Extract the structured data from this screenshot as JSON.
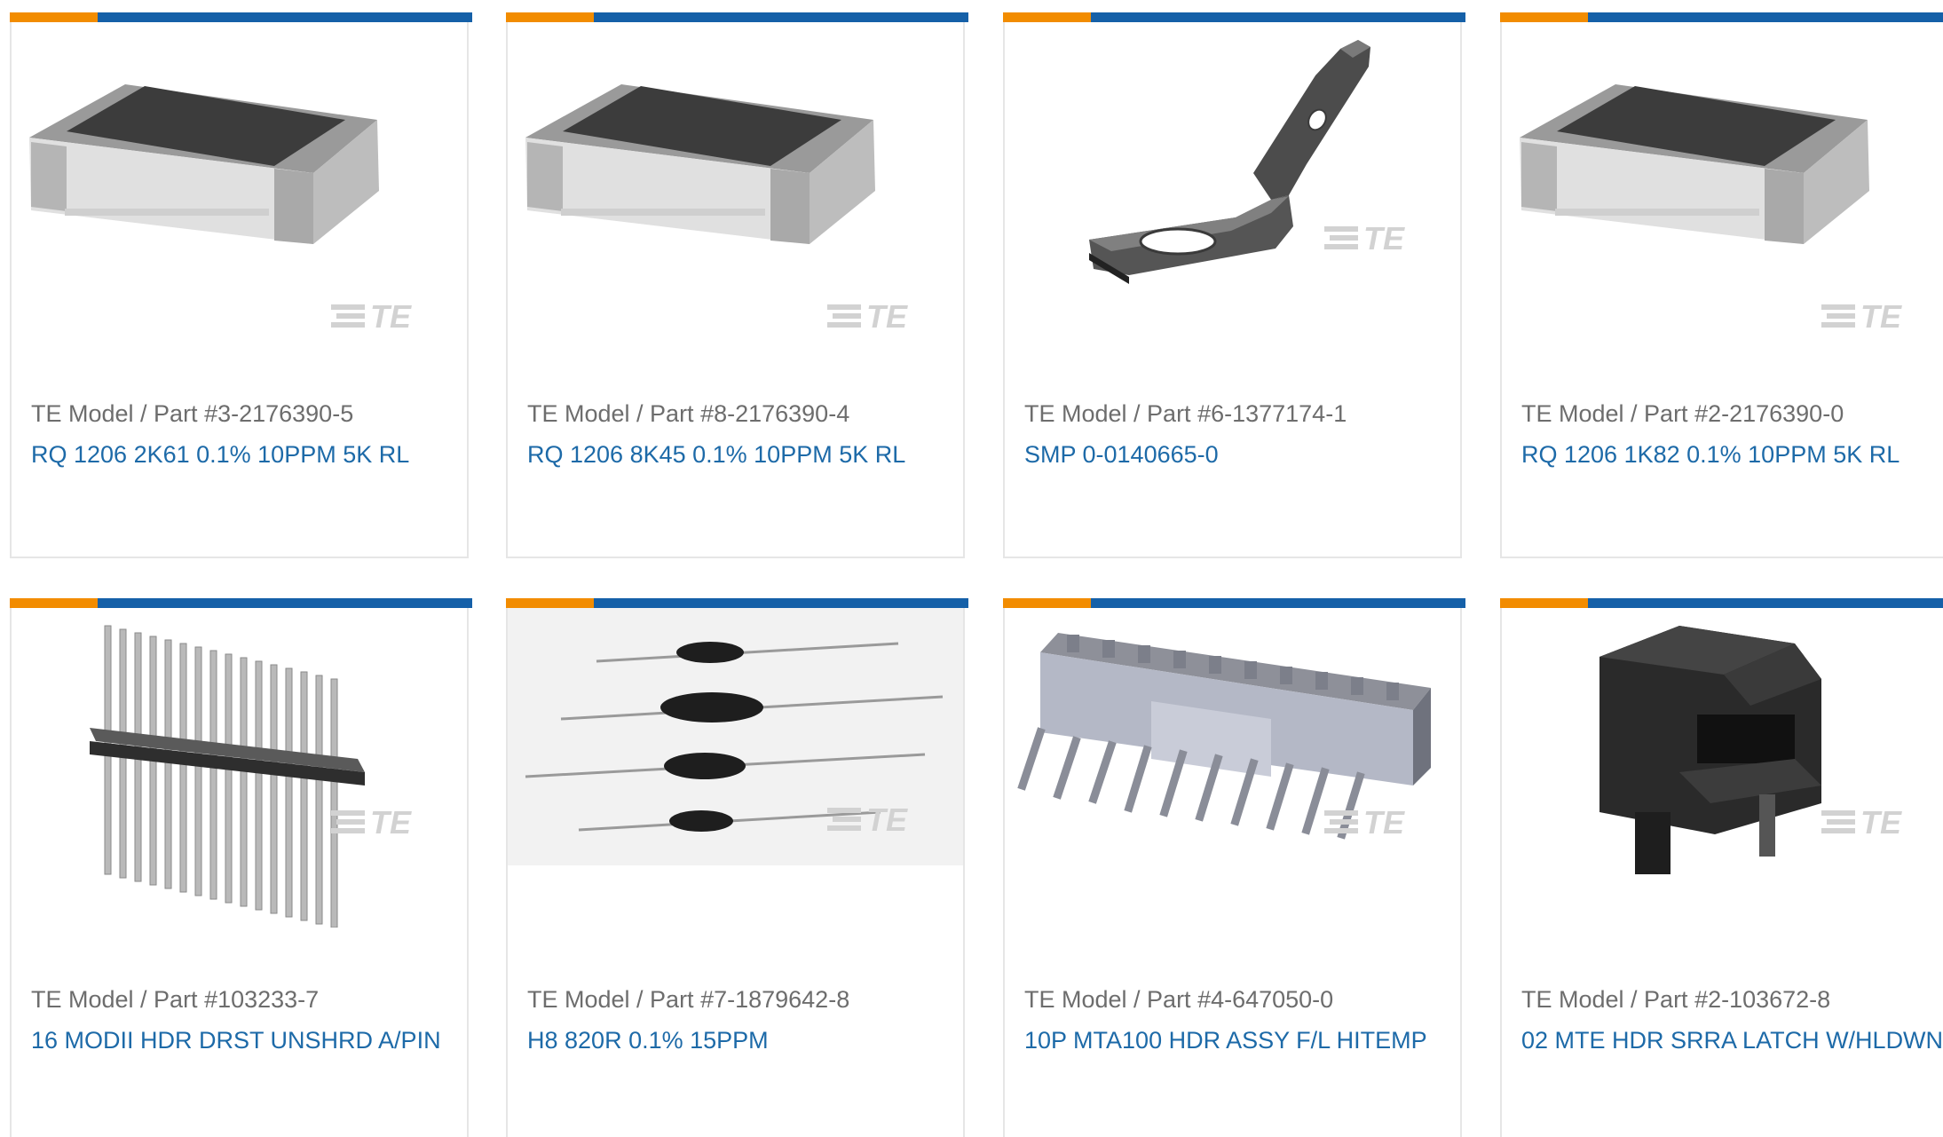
{
  "colors": {
    "accent_orange": "#f28c00",
    "accent_blue": "#1560a8",
    "link": "#1d6aa8",
    "part_text": "#6d6d6d",
    "watermark": "#cfcfcf"
  },
  "watermark_text": "TE",
  "products": [
    {
      "part": "TE Model / Part #3-2176390-5",
      "title": "RQ 1206 2K61 0.1% 10PPM 5K RL",
      "image": "chip-resistor"
    },
    {
      "part": "TE Model / Part #8-2176390-4",
      "title": "RQ 1206 8K45 0.1% 10PPM 5K RL",
      "image": "chip-resistor"
    },
    {
      "part": "TE Model / Part #6-1377174-1",
      "title": "SMP 0-0140665-0",
      "image": "bent-tab-terminal"
    },
    {
      "part": "TE Model / Part #2-2176390-0",
      "title": "RQ 1206 1K82 0.1% 10PPM 5K RL",
      "image": "chip-resistor"
    },
    {
      "part": "TE Model / Part #103233-7",
      "title": "16 MODII HDR DRST UNSHRD A/PIN",
      "image": "pin-header"
    },
    {
      "part": "TE Model / Part #7-1879642-8",
      "title": "H8 820R 0.1% 15PPM",
      "image": "axial-resistors"
    },
    {
      "part": "TE Model / Part #4-647050-0",
      "title": "10P MTA100 HDR ASSY F/L HITEMP",
      "image": "mta-header"
    },
    {
      "part": "TE Model / Part #2-103672-8",
      "title": "02 MTE HDR SRRA LATCH W/HLDWN",
      "image": "latch-header"
    }
  ]
}
